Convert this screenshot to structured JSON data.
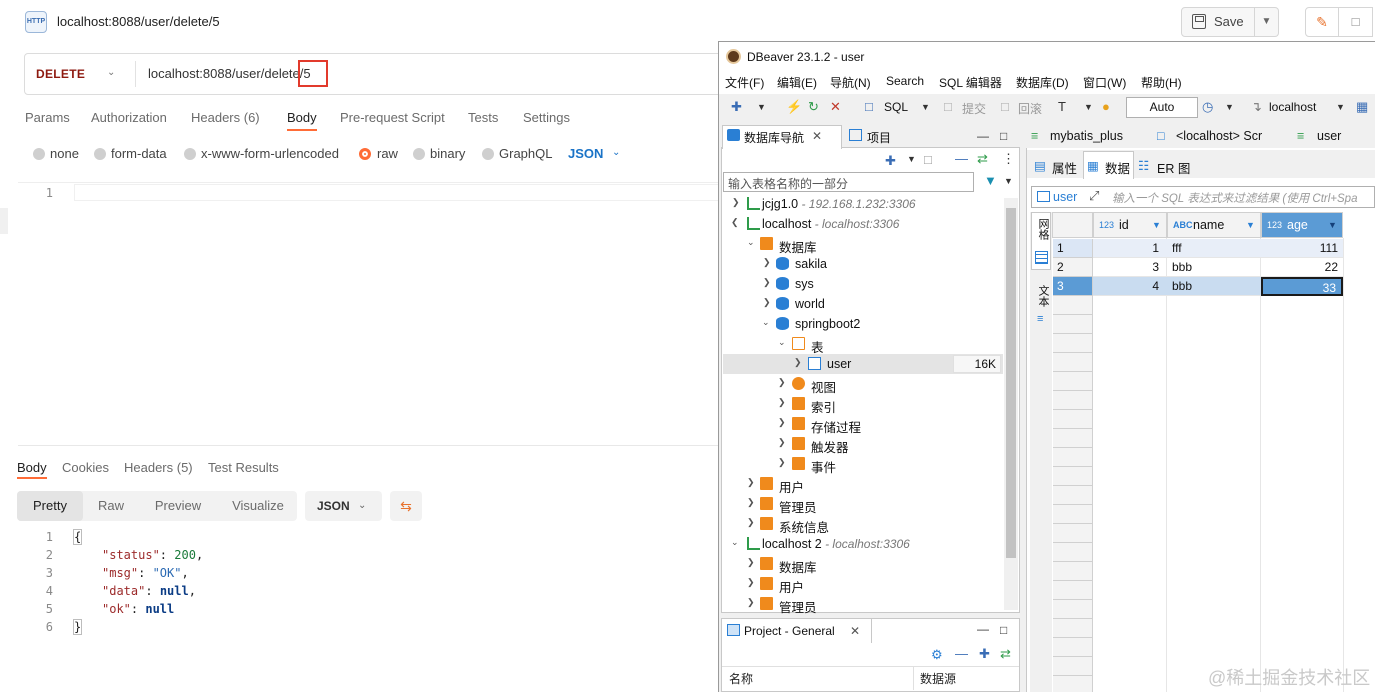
{
  "postman": {
    "http_badge": "HTTP",
    "request_title": "localhost:8088/user/delete/5",
    "save_label": "Save",
    "method": "DELETE",
    "url": "localhost:8088/user/delete/5",
    "request_tabs": [
      "Params",
      "Authorization",
      "Headers (6)",
      "Body",
      "Pre-request Script",
      "Tests",
      "Settings"
    ],
    "body_types": [
      "none",
      "form-data",
      "x-www-form-urlencoded",
      "raw",
      "binary",
      "GraphQL"
    ],
    "body_format": "JSON",
    "editor_line": "1",
    "response_tabs": [
      "Body",
      "Cookies",
      "Headers (5)",
      "Test Results"
    ],
    "view_modes": [
      "Pretty",
      "Raw",
      "Preview",
      "Visualize"
    ],
    "response_format": "JSON",
    "response_lines": [
      "1",
      "2",
      "3",
      "4",
      "5",
      "6"
    ],
    "response_body": {
      "open": "{",
      "close": "}",
      "status_key": "\"status\"",
      "status_val": "200",
      "msg_key": "\"msg\"",
      "msg_val": "\"OK\"",
      "data_key": "\"data\"",
      "data_val": "null",
      "ok_key": "\"ok\"",
      "ok_val": "null"
    }
  },
  "dbeaver": {
    "title": "DBeaver 23.1.2 - user",
    "menu": [
      "文件(F)",
      "编辑(E)",
      "导航(N)",
      "Search",
      "SQL 编辑器",
      "数据库(D)",
      "窗口(W)",
      "帮助(H)"
    ],
    "toolbar": {
      "sql": "SQL",
      "commit": "提交",
      "rollback": "回滚",
      "auto": "Auto",
      "connection": "localhost"
    },
    "nav_tabs": [
      "数据库导航",
      "项目"
    ],
    "filter_placeholder": "输入表格名称的一部分",
    "tree": [
      {
        "label": "jcjg1.0",
        "sub": " - 192.168.1.232:3306"
      },
      {
        "label": "localhost",
        "sub": " - localhost:3306"
      },
      {
        "label": "数据库",
        "sub": ""
      },
      {
        "label": "sakila",
        "sub": ""
      },
      {
        "label": "sys",
        "sub": ""
      },
      {
        "label": "world",
        "sub": ""
      },
      {
        "label": "springboot2",
        "sub": ""
      },
      {
        "label": "表",
        "sub": ""
      },
      {
        "label": "user",
        "sub": ""
      },
      {
        "label": "视图",
        "sub": ""
      },
      {
        "label": "索引",
        "sub": ""
      },
      {
        "label": "存储过程",
        "sub": ""
      },
      {
        "label": "触发器",
        "sub": ""
      },
      {
        "label": "事件",
        "sub": ""
      },
      {
        "label": "用户",
        "sub": ""
      },
      {
        "label": "管理员",
        "sub": ""
      },
      {
        "label": "系统信息",
        "sub": ""
      },
      {
        "label": "localhost 2",
        "sub": " - localhost:3306"
      },
      {
        "label": "数据库",
        "sub": ""
      },
      {
        "label": "用户",
        "sub": ""
      },
      {
        "label": "管理员",
        "sub": ""
      }
    ],
    "user_size": "16K",
    "project_tab": "Project - General",
    "project_cols": [
      "名称",
      "数据源"
    ],
    "editor_tabs": [
      "mybatis_plus",
      "<localhost> Scr",
      "user"
    ],
    "sub_tabs": [
      "属性",
      "数据",
      "ER 图"
    ],
    "table_name": "user",
    "sql_filter_placeholder": "输入一个 SQL 表达式来过滤结果 (使用 Ctrl+Spa",
    "columns": [
      {
        "type": "123",
        "name": "id"
      },
      {
        "type": "ABC",
        "name": "name"
      },
      {
        "type": "123",
        "name": "age"
      }
    ],
    "rows": [
      {
        "n": "1",
        "id": "1",
        "name": "fff",
        "age": "111"
      },
      {
        "n": "2",
        "id": "3",
        "name": "bbb",
        "age": "22"
      },
      {
        "n": "3",
        "id": "4",
        "name": "bbb",
        "age": "33"
      }
    ],
    "vertical_tabs": [
      "网格",
      "文本"
    ]
  },
  "watermark": "@稀土掘金技术社区"
}
